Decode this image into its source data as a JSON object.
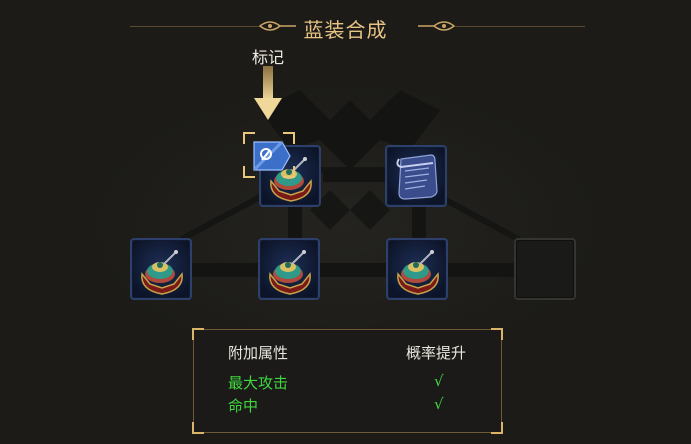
{
  "title": "蓝装合成",
  "mark_label": "标记",
  "slots": [
    {
      "name": "top-left",
      "item": "equipment-top-icon",
      "marked": true
    },
    {
      "name": "top-right",
      "item": "scroll-icon",
      "marked": false
    },
    {
      "name": "bottom-1",
      "item": "equipment-top-icon",
      "marked": false
    },
    {
      "name": "bottom-2",
      "item": "equipment-top-icon",
      "marked": false
    },
    {
      "name": "bottom-3",
      "item": "equipment-top-icon",
      "marked": false
    },
    {
      "name": "bottom-4",
      "item": "",
      "marked": false
    }
  ],
  "panel": {
    "header_left": "附加属性",
    "header_right": "概率提升",
    "rows": [
      {
        "attr": "最大攻击",
        "mark": "√"
      },
      {
        "attr": "命中",
        "mark": "√"
      }
    ]
  },
  "colors": {
    "title": "#e7c486",
    "highlight": "#3fd83f",
    "frame_gold": "#d9b56a"
  }
}
